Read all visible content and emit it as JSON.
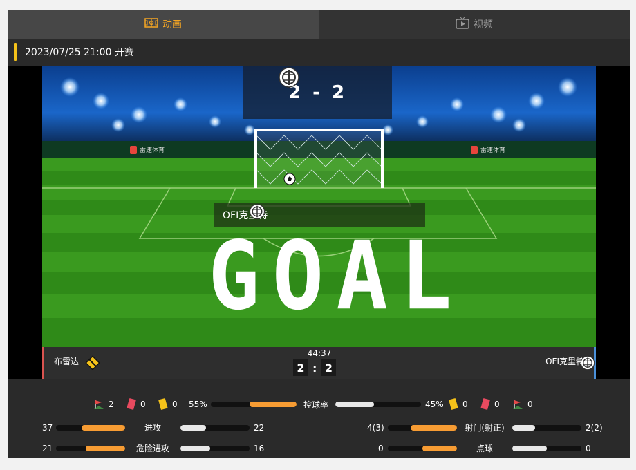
{
  "tabs": [
    {
      "label": "动画",
      "icon": "pitch-icon",
      "active": true
    },
    {
      "label": "视频",
      "icon": "tv-icon",
      "active": false
    }
  ],
  "kickoff": "2023/07/25 21:00 开赛",
  "match": {
    "home": "布雷达",
    "away": "OFI克里特",
    "score_text": "2 - 2",
    "home_score": "2",
    "away_score": "2",
    "clock": "44:37",
    "brand": "雷速体育",
    "event_team": "OFI克里特",
    "event_text": "GOAL"
  },
  "summary": {
    "home_corners": "2",
    "home_red": "0",
    "home_yellow": "0",
    "home_possession": "55%",
    "possession_label": "控球率",
    "away_possession": "45%",
    "away_yellow": "0",
    "away_red": "0",
    "away_corners": "0",
    "home_possession_value": 55,
    "away_possession_value": 45
  },
  "stats_left": [
    {
      "home": "37",
      "label": "进攻",
      "away": "22",
      "home_value": 37,
      "away_value": 22
    },
    {
      "home": "21",
      "label": "危险进攻",
      "away": "16",
      "home_value": 21,
      "away_value": 16
    }
  ],
  "stats_right": [
    {
      "home": "4(3)",
      "label": "射门(射正)",
      "away": "2(2)",
      "home_value": 4,
      "away_value": 2
    },
    {
      "home": "0",
      "label": "点球",
      "away": "0",
      "home_value": 0,
      "away_value": 0
    }
  ],
  "colors": {
    "accent": "#f5a623",
    "home_bar": "#f79c33",
    "away_bar": "#e8e8e8",
    "home_mark": "#d9534f",
    "away_mark": "#4a90d9"
  }
}
